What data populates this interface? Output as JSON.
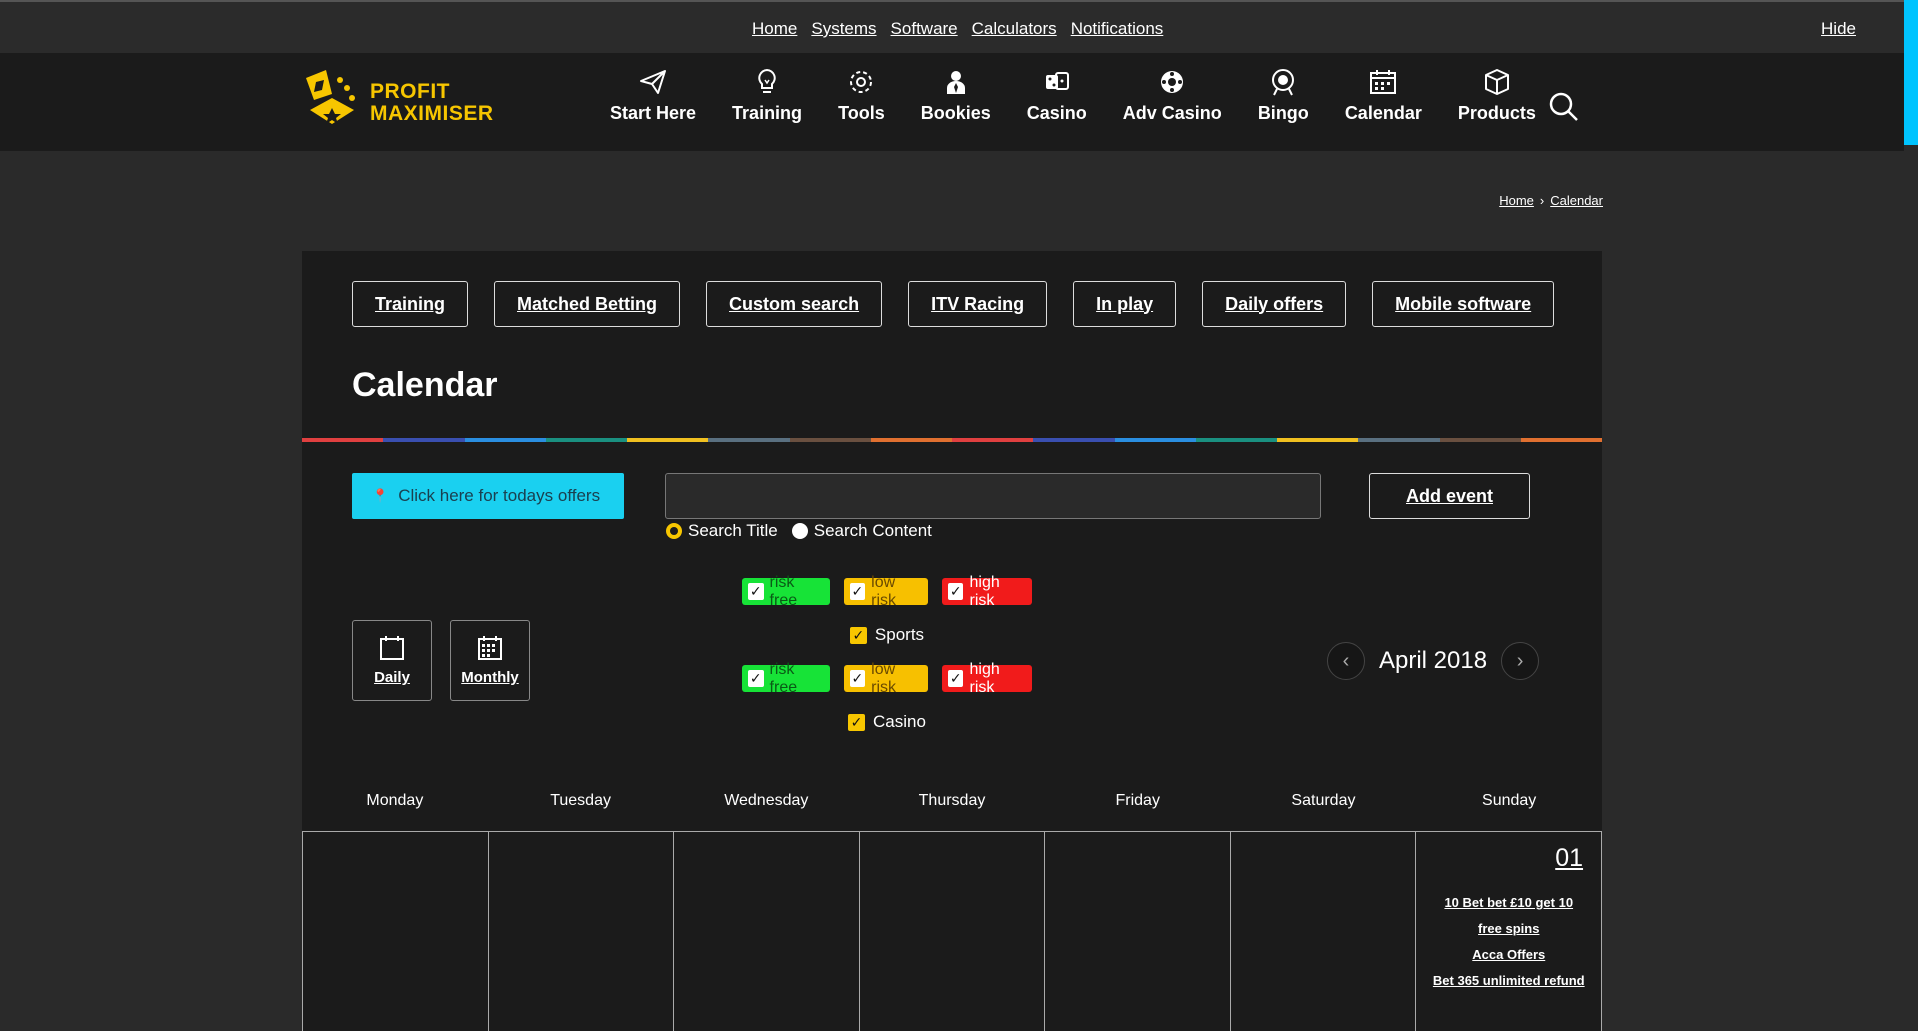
{
  "topbar": {
    "links": [
      "Home",
      "Systems",
      "Software",
      "Calculators",
      "Notifications"
    ],
    "hide": "Hide"
  },
  "logo": {
    "line1": "PROFIT",
    "line2": "MAXIMISER"
  },
  "nav": [
    {
      "label": "Start Here",
      "icon": "paper-plane-icon"
    },
    {
      "label": "Training",
      "icon": "lightbulb-icon"
    },
    {
      "label": "Tools",
      "icon": "gear-icon"
    },
    {
      "label": "Bookies",
      "icon": "person-icon"
    },
    {
      "label": "Casino",
      "icon": "dice-icon"
    },
    {
      "label": "Adv Casino",
      "icon": "roulette-icon"
    },
    {
      "label": "Bingo",
      "icon": "bingo-ball-icon"
    },
    {
      "label": "Calendar",
      "icon": "calendar-icon"
    },
    {
      "label": "Products",
      "icon": "box-icon"
    }
  ],
  "breadcrumb": {
    "home": "Home",
    "current": "Calendar"
  },
  "subnav": [
    "Training",
    "Matched Betting",
    "Custom search",
    "ITV Racing",
    "In play",
    "Daily offers",
    "Mobile software"
  ],
  "page_title": "Calendar",
  "controls": {
    "offers_button": "Click here for todays offers",
    "search_value": "",
    "search_title": "Search Title",
    "search_content": "Search Content",
    "add_event": "Add event"
  },
  "views": {
    "daily": "Daily",
    "monthly": "Monthly"
  },
  "filters": {
    "risk_free": "risk free",
    "low_risk": "low risk",
    "high_risk": "high risk",
    "sports": "Sports",
    "casino": "Casino"
  },
  "month": {
    "label": "April 2018"
  },
  "weekdays": [
    "Monday",
    "Tuesday",
    "Wednesday",
    "Thursday",
    "Friday",
    "Saturday",
    "Sunday"
  ],
  "sunday_cell": {
    "day": "01",
    "events": [
      "10 Bet bet £10 get 10 free spins",
      "Acca Offers",
      "Bet 365 unlimited refund"
    ]
  },
  "colors": {
    "accent": "#f7c600",
    "cyan": "#1ad0f0",
    "green": "#17e337",
    "red": "#f11b1b",
    "bar": [
      "#e04040",
      "#3a4fb0",
      "#2a8ee0",
      "#1a9080",
      "#f0c020",
      "#5a7080",
      "#6a5040",
      "#e07030",
      "#e04040",
      "#3a4fb0",
      "#2a8ee0",
      "#1a9080",
      "#f0c020",
      "#5a7080",
      "#6a5040",
      "#e07030"
    ]
  }
}
